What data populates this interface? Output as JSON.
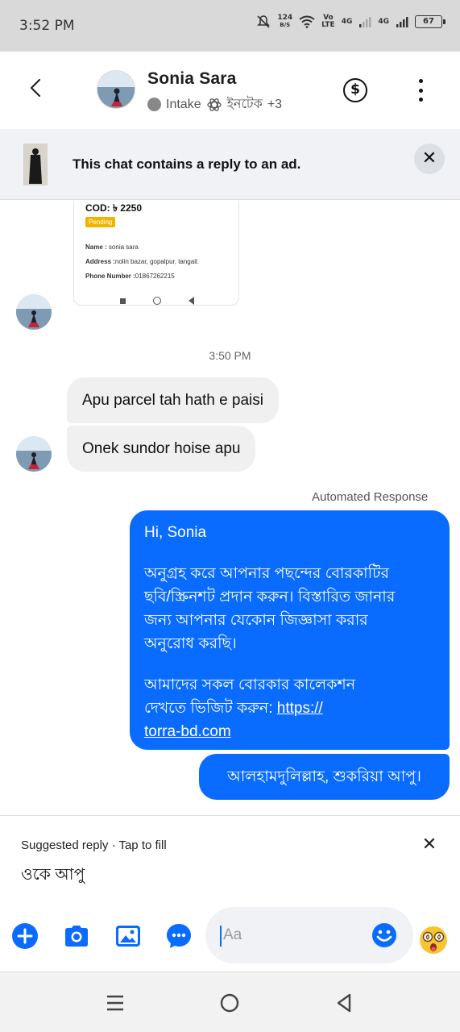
{
  "status_bar": {
    "time": "3:52 PM",
    "net_speed_value": "124",
    "net_speed_unit": "B/S",
    "volte_top": "Vo",
    "volte_bottom": "LTE",
    "signal_1": "4G",
    "signal_2": "4G",
    "battery": "67"
  },
  "header": {
    "contact_name": "Sonia Sara",
    "sub_label": "Intake",
    "sub_label_bn": "ইনটেক",
    "sub_extra": "+3",
    "dollar_symbol": "$"
  },
  "ad_banner": {
    "text": "This chat contains a reply to an ad.",
    "close_symbol": "✕"
  },
  "shared_screenshot": {
    "cod_label": "COD: ৳ 2250",
    "status": "Pending",
    "name_label": "Name :",
    "name_value": "sonia sara",
    "address_label": "Address :",
    "address_value": "nolin bazar, gopalpur, tangail.",
    "phone_label": "Phone Number :",
    "phone_value": "01867262215"
  },
  "messages": {
    "time_separator": "3:50 PM",
    "incoming": [
      {
        "text": "Apu parcel tah hath e paisi"
      },
      {
        "text": "Onek sundor hoise apu"
      }
    ],
    "automated_label": "Automated Response",
    "outgoing_main": {
      "greeting": "Hi, Sonia",
      "para1_line1": "অনুগ্রহ করে আপনার পছন্দের বোরকাটির",
      "para1_line2": "ছবি/স্ক্রিনশট প্রদান করুন। বিস্তারিত জানার",
      "para1_line3": "জন্য আপনার যেকোন জিজ্ঞাসা করার",
      "para1_line4": "অনুরোধ করছি।",
      "para2_line1": "আমাদের সকল  বোরকার কালেকশন",
      "para2_line2": "দেখতে ভিজিট করুন: ",
      "link_part1": "https://",
      "link_part2": "torra-bd.com"
    },
    "outgoing_2": "আলহামদুলিল্লাহ, শুকরিয়া আপু।"
  },
  "suggested": {
    "heading": "Suggested reply · Tap to fill",
    "text": "ওকে আপু",
    "close_symbol": "✕"
  },
  "composer": {
    "placeholder": "Aa",
    "icons": [
      "plus-icon",
      "camera-icon",
      "gallery-icon",
      "chat-bubble-icon",
      "smiley-icon",
      "emoji-icon"
    ]
  },
  "colors": {
    "accent": "#0a6cff",
    "incoming_bubble": "#f0f0f0",
    "status_bar_bg": "#d9d9d9"
  }
}
